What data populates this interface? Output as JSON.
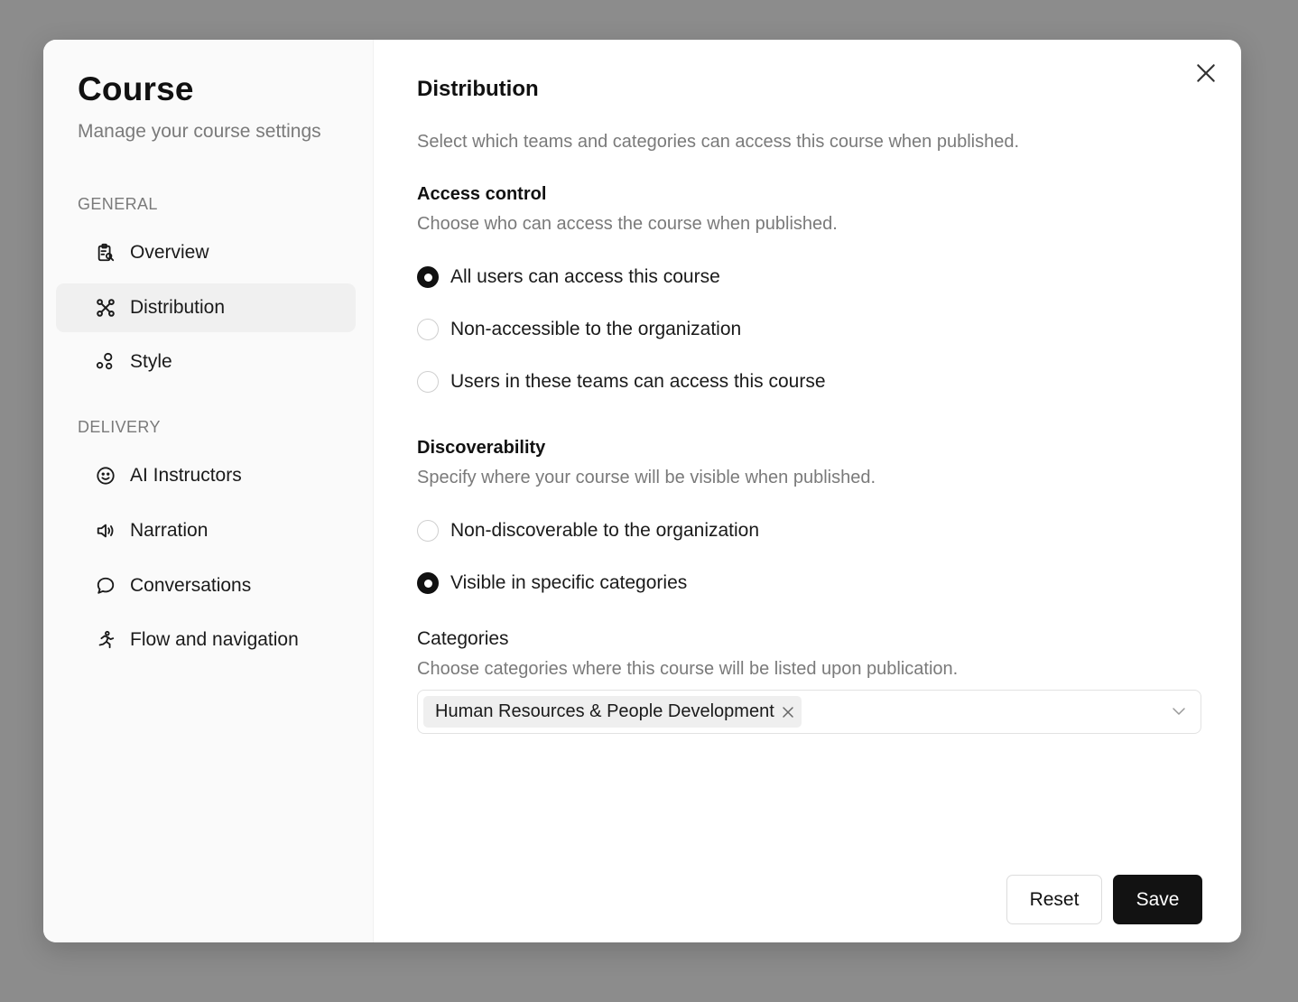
{
  "sidebar": {
    "title": "Course",
    "subtitle": "Manage your course settings",
    "sections": [
      {
        "label": "GENERAL",
        "items": [
          {
            "label": "Overview",
            "icon": "clipboard-search-icon"
          },
          {
            "label": "Distribution",
            "icon": "network-icon",
            "active": true
          },
          {
            "label": "Style",
            "icon": "shapes-icon"
          }
        ]
      },
      {
        "label": "DELIVERY",
        "items": [
          {
            "label": "AI Instructors",
            "icon": "smile-icon"
          },
          {
            "label": "Narration",
            "icon": "speaker-icon"
          },
          {
            "label": "Conversations",
            "icon": "chat-bubble-icon"
          },
          {
            "label": "Flow and navigation",
            "icon": "running-person-icon"
          }
        ]
      }
    ]
  },
  "content": {
    "title": "Distribution",
    "description": "Select which teams and categories can access this course when published.",
    "access_control": {
      "title": "Access control",
      "description": "Choose who can access the course when published.",
      "options": [
        {
          "label": "All users can access this course",
          "checked": true
        },
        {
          "label": "Non-accessible to the organization",
          "checked": false
        },
        {
          "label": "Users in these teams can access this course",
          "checked": false
        }
      ]
    },
    "discoverability": {
      "title": "Discoverability",
      "description": "Specify where your course will be visible when published.",
      "options": [
        {
          "label": "Non-discoverable to the organization",
          "checked": false
        },
        {
          "label": "Visible in specific categories",
          "checked": true
        }
      ]
    },
    "categories": {
      "label": "Categories",
      "description": "Choose categories where this course will be listed upon publication.",
      "selected": [
        "Human Resources & People Development"
      ]
    }
  },
  "footer": {
    "reset_label": "Reset",
    "save_label": "Save"
  },
  "colors": {
    "primary_button": "#121212",
    "muted_text": "#7a7a7a",
    "sidebar_bg": "#fafafa",
    "active_item_bg": "#f0f0f0"
  }
}
